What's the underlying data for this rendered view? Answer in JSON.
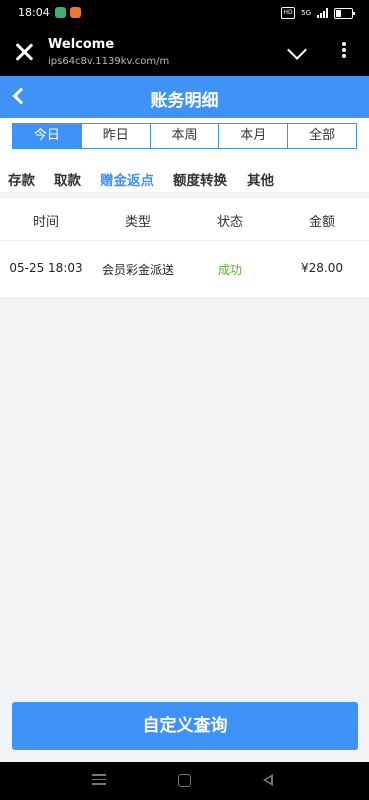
{
  "status_bar": {
    "time": "18:04",
    "hd": "HD",
    "network": "5G"
  },
  "browser": {
    "title": "Welcome",
    "url": "ips64c8v.1139kv.com/m"
  },
  "header": {
    "title": "账务明细"
  },
  "period_tabs": [
    "今日",
    "昨日",
    "本周",
    "本月",
    "全部"
  ],
  "period_active": "今日",
  "category_tabs": [
    "存款",
    "取款",
    "赠金返点",
    "额度转换",
    "其他"
  ],
  "category_active": "赠金返点",
  "table": {
    "columns": [
      "时间",
      "类型",
      "状态",
      "金额"
    ],
    "rows": [
      {
        "time": "05-25 18:03",
        "type": "会员彩金派送",
        "status": "成功",
        "amount": "¥28.00"
      }
    ]
  },
  "query_button": {
    "label": "自定义查询"
  },
  "colors": {
    "accent": "#3f93f7",
    "success": "#54b52d",
    "background": "#f2f3f5"
  }
}
